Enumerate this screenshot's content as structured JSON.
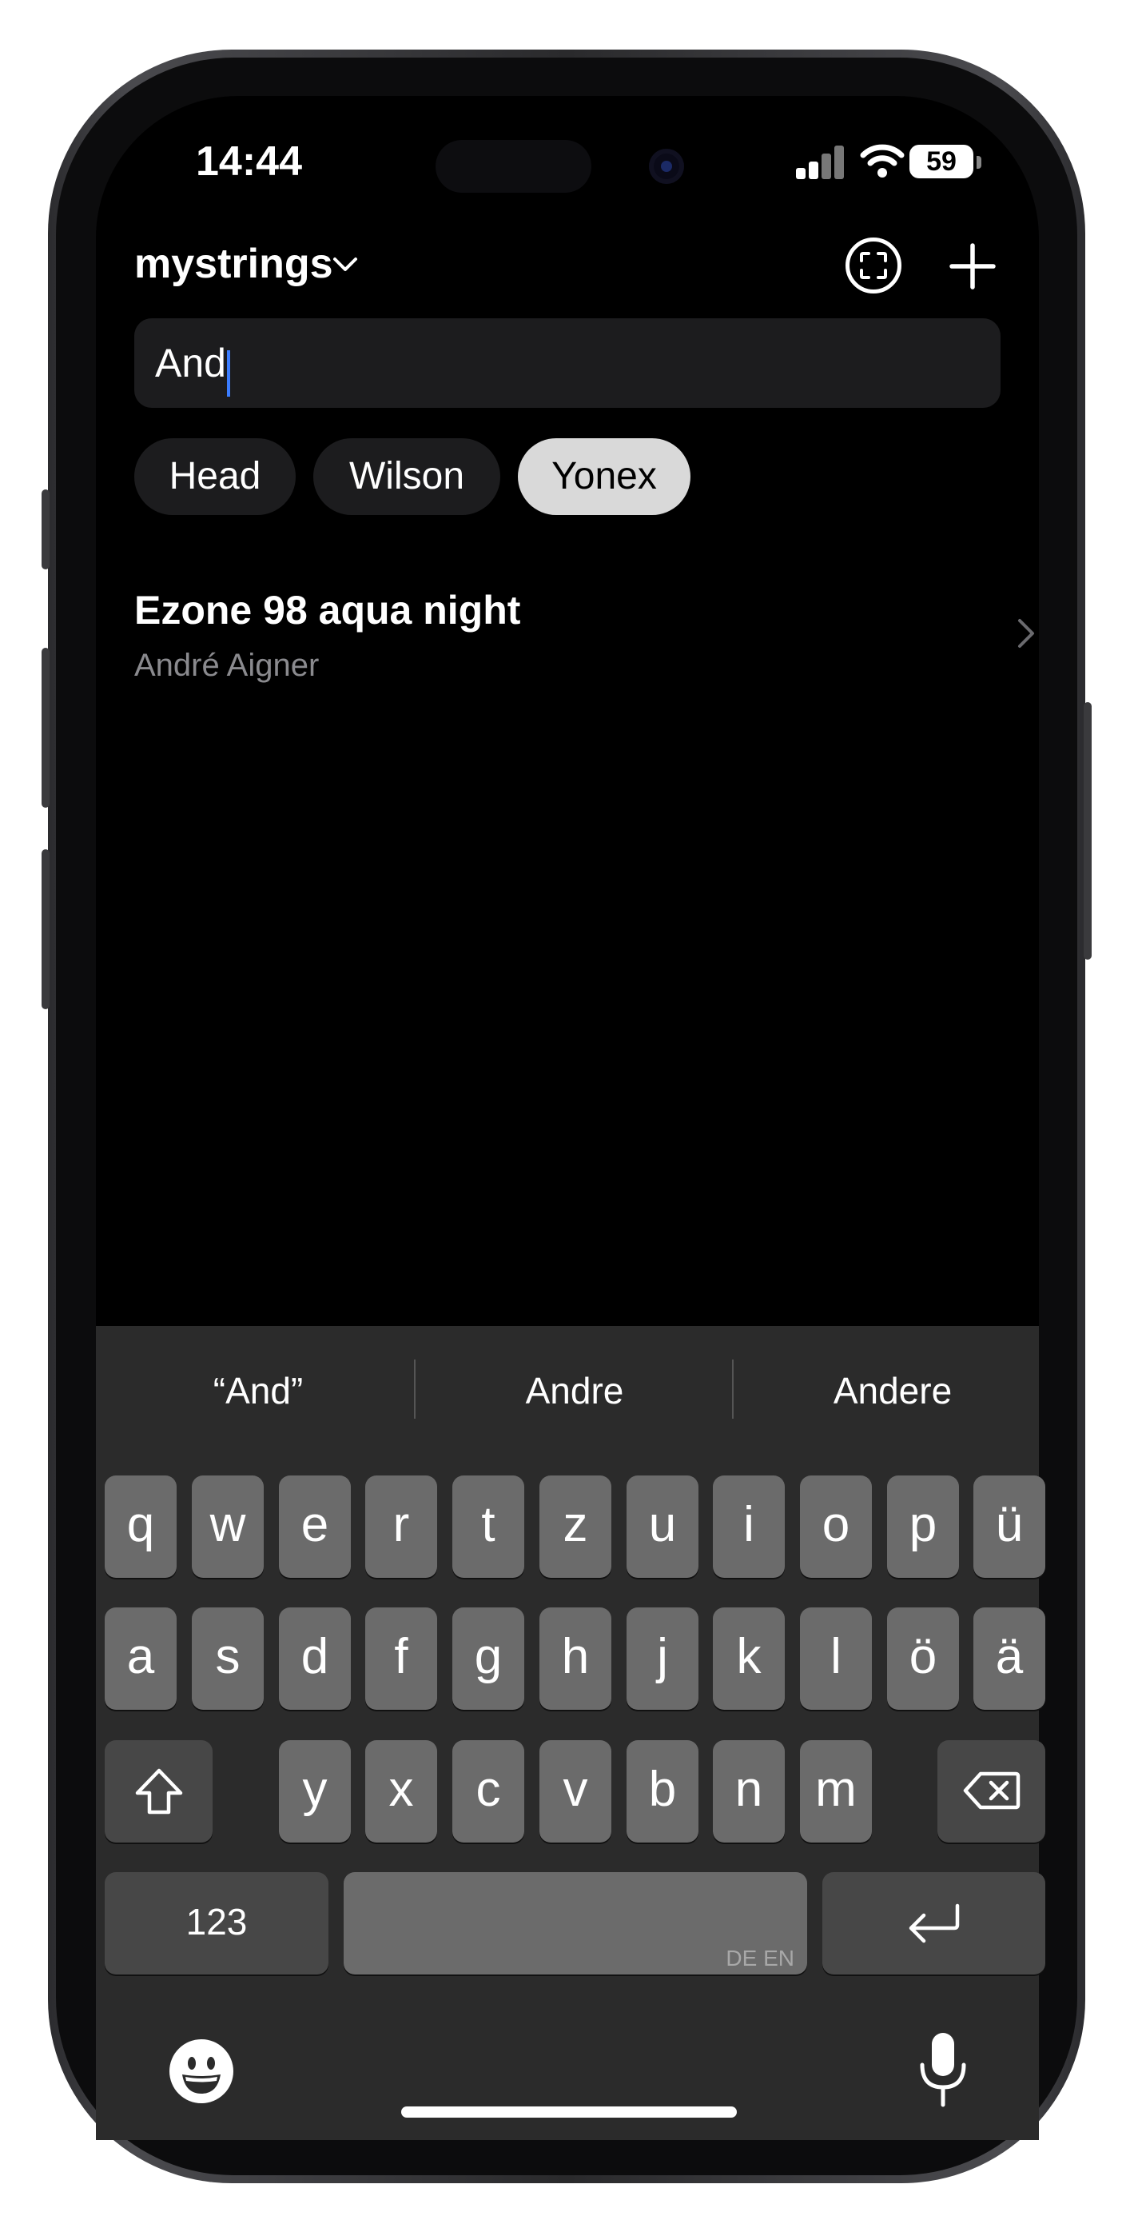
{
  "status": {
    "time": "14:44",
    "battery": "59"
  },
  "header": {
    "title": "mystrings"
  },
  "search": {
    "value": "And"
  },
  "filters": [
    {
      "label": "Head",
      "selected": false
    },
    {
      "label": "Wilson",
      "selected": false
    },
    {
      "label": "Yonex",
      "selected": true
    }
  ],
  "results": [
    {
      "title": "Ezone 98 aqua night",
      "subtitle": "André Aigner"
    }
  ],
  "keyboard": {
    "suggestions": [
      "“And”",
      "Andre",
      "Andere"
    ],
    "row1": [
      "q",
      "w",
      "e",
      "r",
      "t",
      "z",
      "u",
      "i",
      "o",
      "p",
      "ü"
    ],
    "row2": [
      "a",
      "s",
      "d",
      "f",
      "g",
      "h",
      "j",
      "k",
      "l",
      "ö",
      "ä"
    ],
    "row3": [
      "y",
      "x",
      "c",
      "v",
      "b",
      "n",
      "m"
    ],
    "numbers_label": "123",
    "space_languages": "DE EN"
  },
  "colors": {
    "cursor": "#3b7dff",
    "chip_selected": "#d9d9d9",
    "background": "#000000"
  }
}
